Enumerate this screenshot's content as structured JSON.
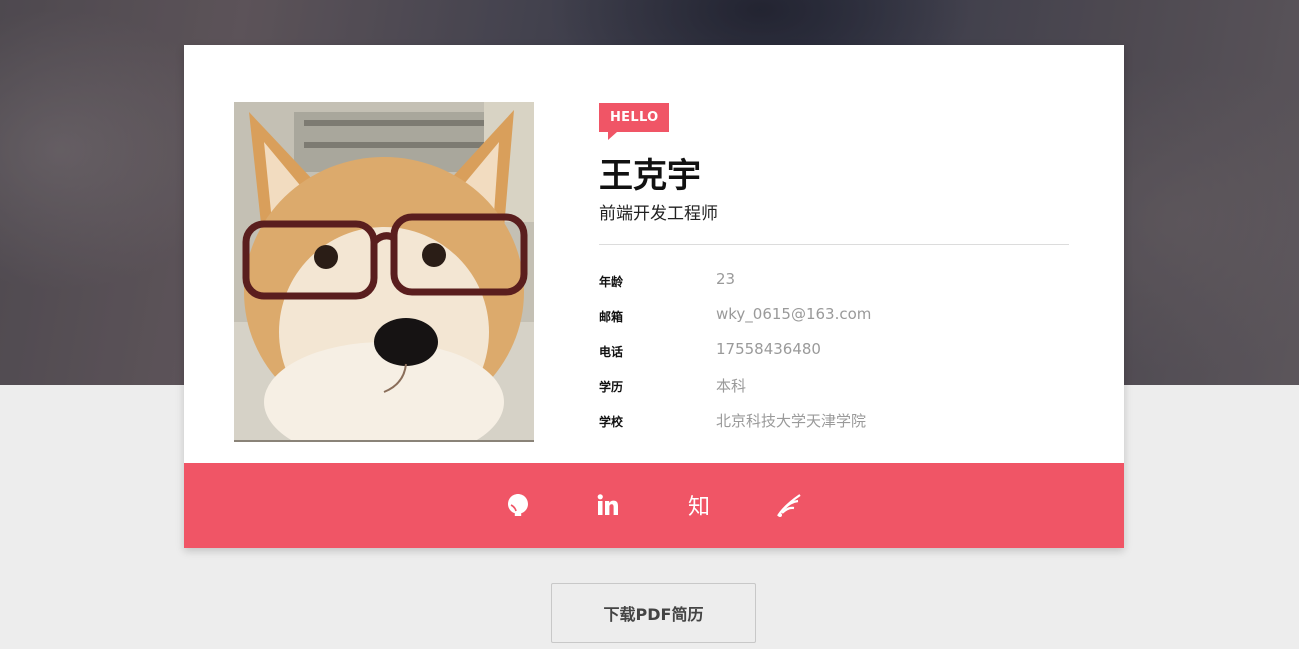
{
  "profile": {
    "hello_tag": "HELLO",
    "name": "王克宇",
    "job_title": "前端开发工程师",
    "fields": [
      {
        "label": "年龄",
        "value": "23"
      },
      {
        "label": "邮箱",
        "value": "wky_0615@163.com"
      },
      {
        "label": "电话",
        "value": "17558436480"
      },
      {
        "label": "学历",
        "value": "本科"
      },
      {
        "label": "学校",
        "value": "北京科技大学天津学院"
      }
    ]
  },
  "social": {
    "icons": [
      "github-icon",
      "linkedin-icon",
      "zhihu-icon",
      "blog-feather-icon"
    ],
    "zhihu_glyph": "知"
  },
  "actions": {
    "download_pdf_label": "下载PDF简历"
  },
  "colors": {
    "accent": "#f05566",
    "page_bg": "#ededed",
    "card_bg": "#ffffff",
    "value_text": "#9a9a9a"
  }
}
